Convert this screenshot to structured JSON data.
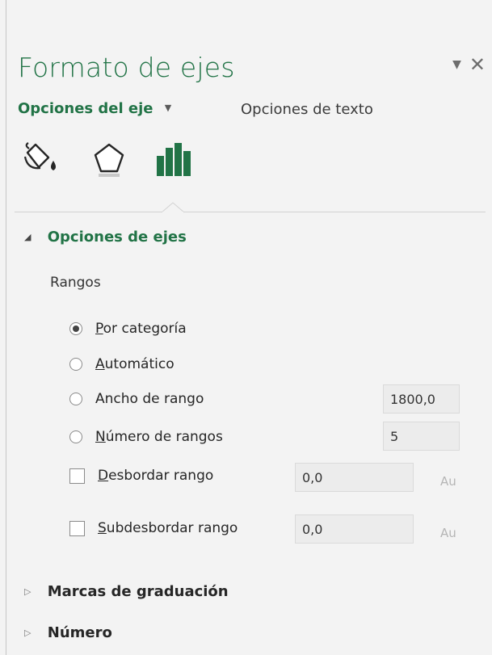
{
  "pane": {
    "title": "Formato de ejes",
    "tabs": [
      {
        "label": "Opciones del eje",
        "active": true
      },
      {
        "label": "Opciones de texto",
        "active": false
      }
    ],
    "icons": [
      "fill-bucket-icon",
      "pentagon-icon",
      "bar-chart-icon"
    ],
    "accent_color": "#217346"
  },
  "sections": [
    {
      "label": "Opciones de ejes",
      "expanded": true,
      "group_label": "Rangos",
      "options": [
        {
          "type": "radio",
          "label_pre": "",
          "label_ul": "P",
          "label_post": "or categoría",
          "checked": true
        },
        {
          "type": "radio",
          "label_pre": "",
          "label_ul": "A",
          "label_post": "utomático",
          "checked": false
        },
        {
          "type": "radio",
          "label_pre": "Ancho de rango",
          "label_ul": "",
          "label_post": "",
          "checked": false,
          "value": "1800,0"
        },
        {
          "type": "radio",
          "label_pre": "",
          "label_ul": "N",
          "label_post": "úmero de rangos",
          "checked": false,
          "value": "5"
        },
        {
          "type": "checkbox",
          "label_pre": "",
          "label_ul": "D",
          "label_post": "esbordar rango",
          "checked": false,
          "value": "0,0",
          "auto": "Au"
        },
        {
          "type": "checkbox",
          "label_pre": "",
          "label_ul": "S",
          "label_post": "ubdesbordar rango",
          "checked": false,
          "value": "0,0",
          "auto": "Au"
        }
      ]
    },
    {
      "label": "Marcas de graduación",
      "expanded": false
    },
    {
      "label": "Número",
      "expanded": false
    }
  ]
}
